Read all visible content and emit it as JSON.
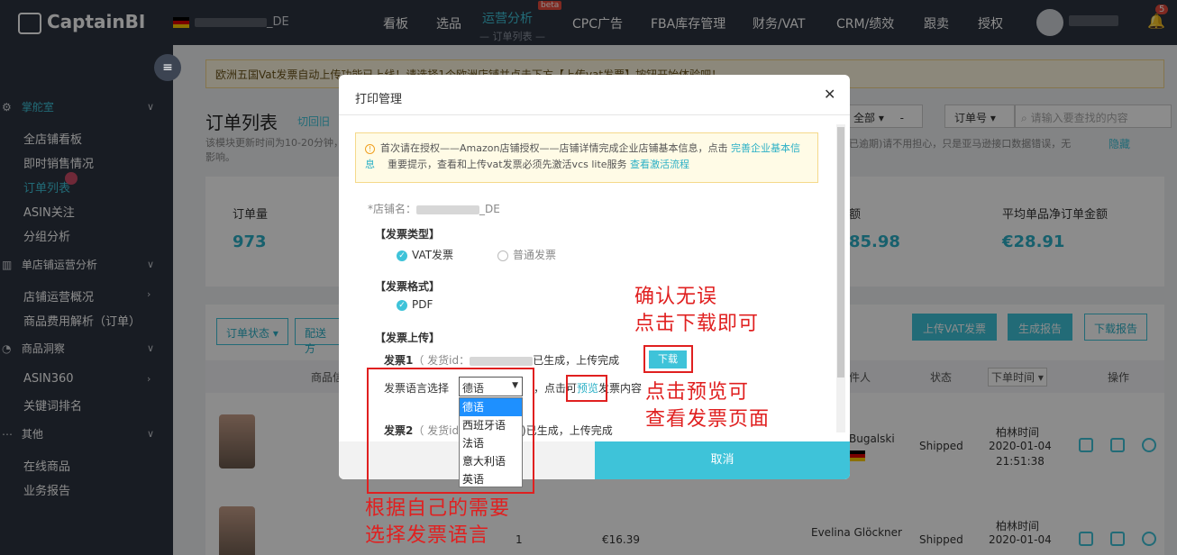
{
  "app": {
    "logo": "CaptainBI",
    "store_suffix": "_DE",
    "notif_count": "5"
  },
  "topnav": {
    "items": [
      "看板",
      "选品",
      "运营分析",
      "CPC广告",
      "FBA库存管理",
      "财务/VAT",
      "CRM/绩效",
      "跟卖",
      "授权"
    ],
    "active_sub": "— 订单列表 —",
    "beta": "beta"
  },
  "sidebar": {
    "groups": [
      {
        "label": "掌舵室"
      },
      {
        "label": "单店铺运营分析"
      },
      {
        "label": "商品洞察"
      },
      {
        "label": "其他"
      }
    ],
    "items": [
      "全店铺看板",
      "即时销售情况",
      "订单列表",
      "ASIN关注",
      "分组分析",
      "店铺运营概况",
      "商品费用解析（订单）",
      "ASIN360",
      "关键词排名",
      "在线商品",
      "业务报告"
    ]
  },
  "page": {
    "notice": "欧洲五国Vat发票自动上传功能已上线！请选择1个欧洲店铺并点击下方【上传vat发票】按钮开始体验吧！",
    "title": "订单列表",
    "switch_link": "切回旧",
    "desc": "该模块更新时间为10-20分钟，影响。",
    "desc_right": "已逾期)请不用担心，只是亚马逊接口数据错误，无",
    "hide": "隐藏",
    "filter_all": "全部",
    "filter_dash": "-",
    "filter_order": "订单号",
    "search_placeholder": "请输入要查找的内容"
  },
  "stats": {
    "order_count_label": "订单量",
    "order_count": "973",
    "amount_partial_label": "额",
    "amount_partial": "85.98",
    "avg_label": "平均单品净订单金额",
    "avg_value": "€28.91"
  },
  "toolbar": {
    "order_status": "订单状态",
    "ship_method": "配送方",
    "upload_vat": "上传VAT发票",
    "gen_report": "生成报告",
    "download_report": "下载报告"
  },
  "table": {
    "headers": [
      "商品信",
      "件人",
      "状态",
      "下单时间",
      "操作"
    ],
    "rows": [
      {
        "buyer": "Bugalski",
        "status": "Shipped",
        "city": "柏林时间",
        "date": "2020-01-04",
        "time": "21:51:38"
      },
      {
        "qty": "1",
        "price": "€16.39",
        "buyer": "Evelina Glöckner",
        "status": "Shipped",
        "city": "柏林时间",
        "date": "2020-01-04"
      }
    ]
  },
  "modal": {
    "title": "打印管理",
    "tip_text": "首次请在授权——Amazon店铺授权——店铺详情完成企业店铺基本信息，点击",
    "tip_link1": "完善企业基本信息",
    "tip_text2": "重要提示，查看和上传vat发票必须先激活vcs lite服务",
    "tip_link2": "查看激活流程",
    "store_label": "*店铺名：",
    "invoice_type_label": "【发票类型】",
    "vat_invoice": "VAT发票",
    "normal_invoice": "普通发票",
    "invoice_format_label": "【发票格式】",
    "pdf": "PDF",
    "invoice_upload_label": "【发票上传】",
    "invoice1_prefix": "发票1",
    "invoice1_mid": "（ 发货id：",
    "invoice1_suffix": "已生成，上传完成",
    "download": "下载",
    "lang_label": "发票语言选择",
    "lang_selected": "德语",
    "click_can": "，点击可",
    "preview": "预览",
    "invoice_content": "发票内容",
    "invoice2_prefix": "发票2",
    "invoice2_mid": "（ 发货id",
    "invoice2_suffix": "n1Cs)已生成，上传完成",
    "cancel": "取消"
  },
  "dropdown": {
    "options": [
      "德语",
      "西班牙语",
      "法语",
      "意大利语",
      "英语"
    ]
  },
  "annotations": {
    "confirm_line1": "确认无误",
    "confirm_line2": "点击下载即可",
    "preview_line1": "点击预览可",
    "preview_line2": "查看发票页面",
    "lang_line1": "根据自己的需要",
    "lang_line2": "选择发票语言"
  },
  "colors": {
    "nav_bg": "#2d3440",
    "accent": "#3ec3d9",
    "annotation": "#e02020"
  }
}
